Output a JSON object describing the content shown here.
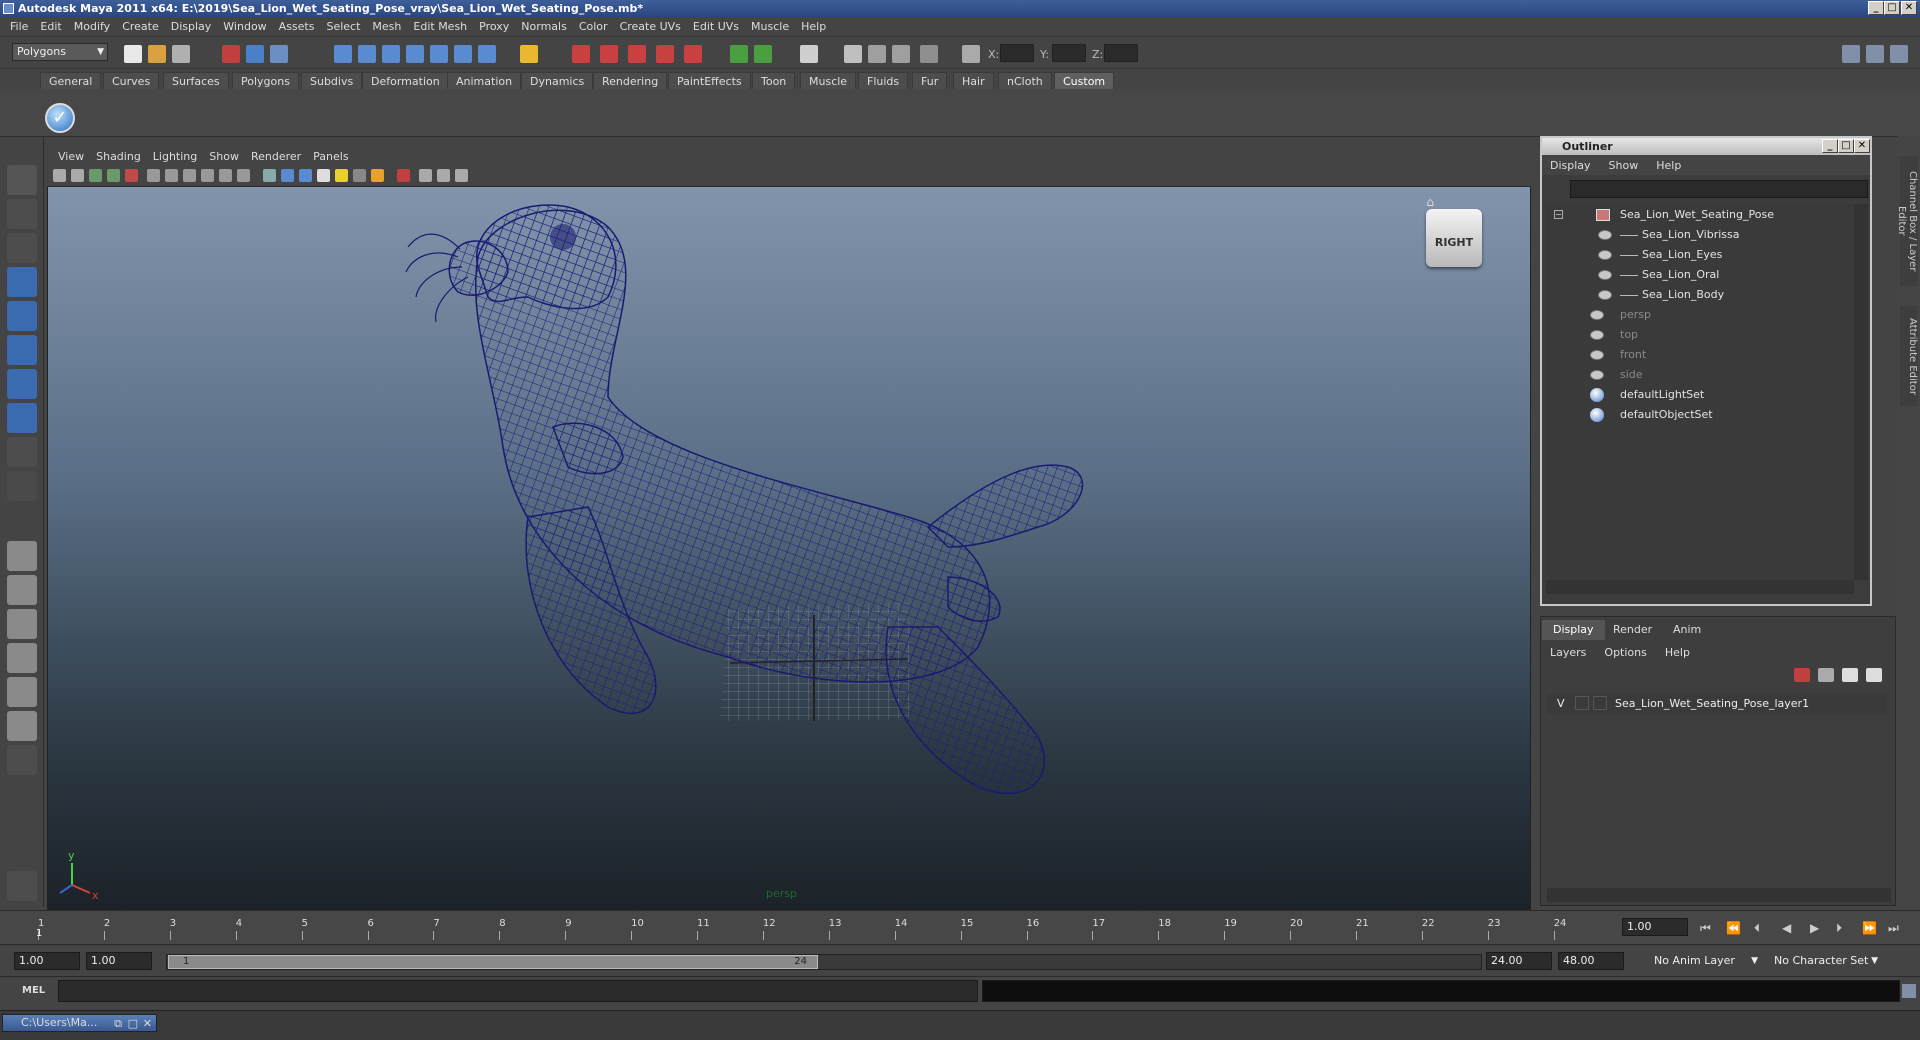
{
  "window": {
    "title": "Autodesk Maya 2011 x64: E:\\2019\\Sea_Lion_Wet_Seating_Pose_vray\\Sea_Lion_Wet_Seating_Pose.mb*",
    "min": "_",
    "max": "□",
    "close": "✕"
  },
  "menubar": [
    "File",
    "Edit",
    "Modify",
    "Create",
    "Display",
    "Window",
    "Assets",
    "Select",
    "Mesh",
    "Edit Mesh",
    "Proxy",
    "Normals",
    "Color",
    "Create UVs",
    "Edit UVs",
    "Muscle",
    "Help"
  ],
  "statusline": {
    "mode": "Polygons",
    "x_label": "X:",
    "y_label": "Y:",
    "z_label": "Z:"
  },
  "shelf_tabs": [
    "General",
    "Curves",
    "Surfaces",
    "Polygons",
    "Subdivs",
    "Deformation",
    "Animation",
    "Dynamics",
    "Rendering",
    "PaintEffects",
    "Toon",
    "Muscle",
    "Fluids",
    "Fur",
    "Hair",
    "nCloth",
    "Custom"
  ],
  "shelf_active": "Custom",
  "viewport": {
    "menu": [
      "View",
      "Shading",
      "Lighting",
      "Show",
      "Renderer",
      "Panels"
    ],
    "cube_label": "RIGHT",
    "camera_label": "persp",
    "axis_y": "y",
    "axis_x": "x"
  },
  "outliner": {
    "title": "Outliner",
    "menu": [
      "Display",
      "Show",
      "Help"
    ],
    "items": [
      {
        "label": "Sea_Lion_Wet_Seating_Pose",
        "indent": 0,
        "kind": "group",
        "dim": false
      },
      {
        "label": "Sea_Lion_Vibrissa",
        "indent": 1,
        "kind": "mesh",
        "dim": false
      },
      {
        "label": "Sea_Lion_Eyes",
        "indent": 1,
        "kind": "mesh",
        "dim": false
      },
      {
        "label": "Sea_Lion_Oral",
        "indent": 1,
        "kind": "mesh",
        "dim": false
      },
      {
        "label": "Sea_Lion_Body",
        "indent": 1,
        "kind": "mesh",
        "dim": false
      },
      {
        "label": "persp",
        "indent": 0,
        "kind": "camera",
        "dim": true
      },
      {
        "label": "top",
        "indent": 0,
        "kind": "camera",
        "dim": true
      },
      {
        "label": "front",
        "indent": 0,
        "kind": "camera",
        "dim": true
      },
      {
        "label": "side",
        "indent": 0,
        "kind": "camera",
        "dim": true
      },
      {
        "label": "defaultLightSet",
        "indent": 0,
        "kind": "set",
        "dim": false
      },
      {
        "label": "defaultObjectSet",
        "indent": 0,
        "kind": "set",
        "dim": false
      }
    ]
  },
  "layer_editor": {
    "tabs": [
      "Display",
      "Render",
      "Anim"
    ],
    "active_tab": "Display",
    "menu": [
      "Layers",
      "Options",
      "Help"
    ],
    "layer_visibility": "V",
    "layer_name": "Sea_Lion_Wet_Seating_Pose_layer1"
  },
  "right_tabs": [
    "Channel Box / Layer Editor",
    "Attribute Editor"
  ],
  "timeline": {
    "ticks": [
      "1",
      "2",
      "3",
      "4",
      "5",
      "6",
      "7",
      "8",
      "9",
      "10",
      "11",
      "12",
      "13",
      "14",
      "15",
      "16",
      "17",
      "18",
      "19",
      "20",
      "21",
      "22",
      "23",
      "24"
    ],
    "playhead_label": "1",
    "current_frame": "1.00"
  },
  "range": {
    "start": "1.00",
    "playback_start": "1.00",
    "handle_start": "1",
    "handle_end": "24",
    "playback_end": "24.00",
    "end": "48.00",
    "anim_layer": "No Anim Layer",
    "character_set": "No Character Set"
  },
  "command_line": {
    "label": "MEL"
  },
  "taskbar": {
    "item": "C:\\Users\\Ma..."
  }
}
